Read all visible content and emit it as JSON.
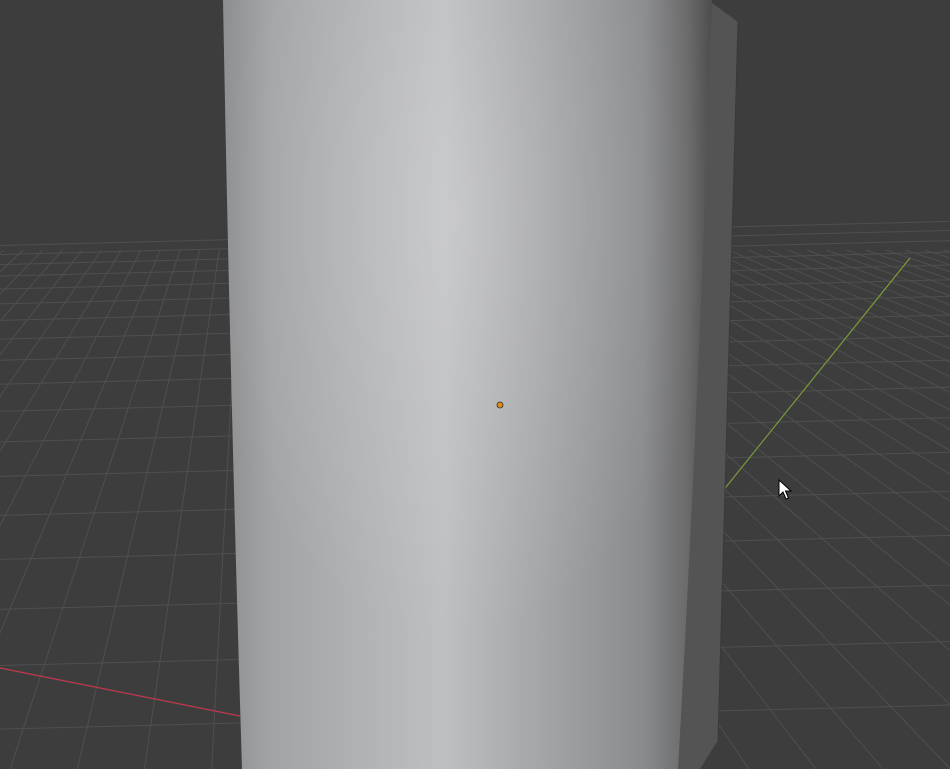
{
  "viewport": {
    "background_color": "#3d3d3d",
    "grid_line_color": "#4f4f4f",
    "x_axis_color": "#c0394b",
    "y_axis_color": "#7a9a36",
    "object_shape": "cylinder",
    "object_face_color": "#b6b7b9",
    "object_side_color": "#555454",
    "object_origin_color": "#e08a1a",
    "cursor_icon": "arrow-cursor-icon"
  }
}
